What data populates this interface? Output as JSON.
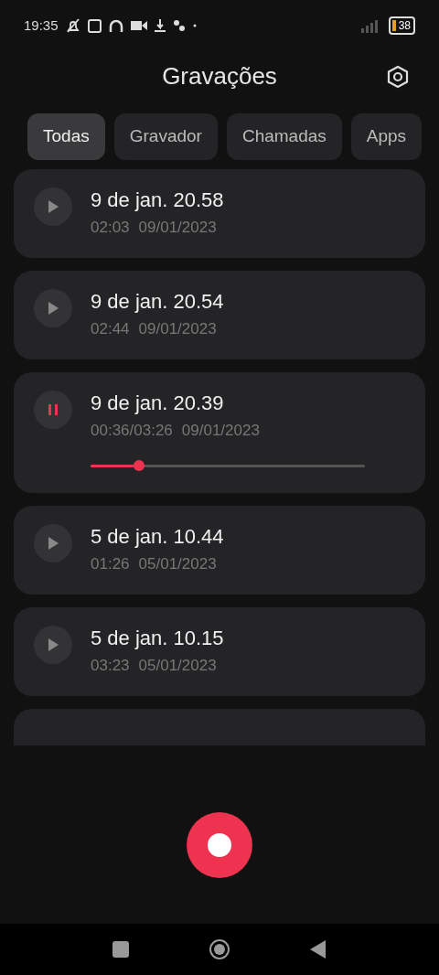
{
  "status_bar": {
    "time": "19:35",
    "battery": "38"
  },
  "header": {
    "title": "Gravações"
  },
  "tabs": [
    {
      "label": "Todas",
      "selected": true
    },
    {
      "label": "Gravador",
      "selected": false
    },
    {
      "label": "Chamadas",
      "selected": false
    },
    {
      "label": "Apps",
      "selected": false
    }
  ],
  "recordings": [
    {
      "title": "9 de jan. 20.58",
      "duration": "02:03",
      "date": "09/01/2023",
      "playing": false
    },
    {
      "title": "9 de jan. 20.54",
      "duration": "02:44",
      "date": "09/01/2023",
      "playing": false
    },
    {
      "title": "9 de jan. 20.39",
      "duration": "00:36/03:26",
      "date": "09/01/2023",
      "playing": true,
      "level": 0.175
    },
    {
      "title": "5 de jan. 10.44",
      "duration": "01:26",
      "date": "05/01/2023",
      "playing": false
    },
    {
      "title": "5 de jan. 10.15",
      "duration": "03:23",
      "date": "05/01/2023",
      "playing": false
    }
  ]
}
